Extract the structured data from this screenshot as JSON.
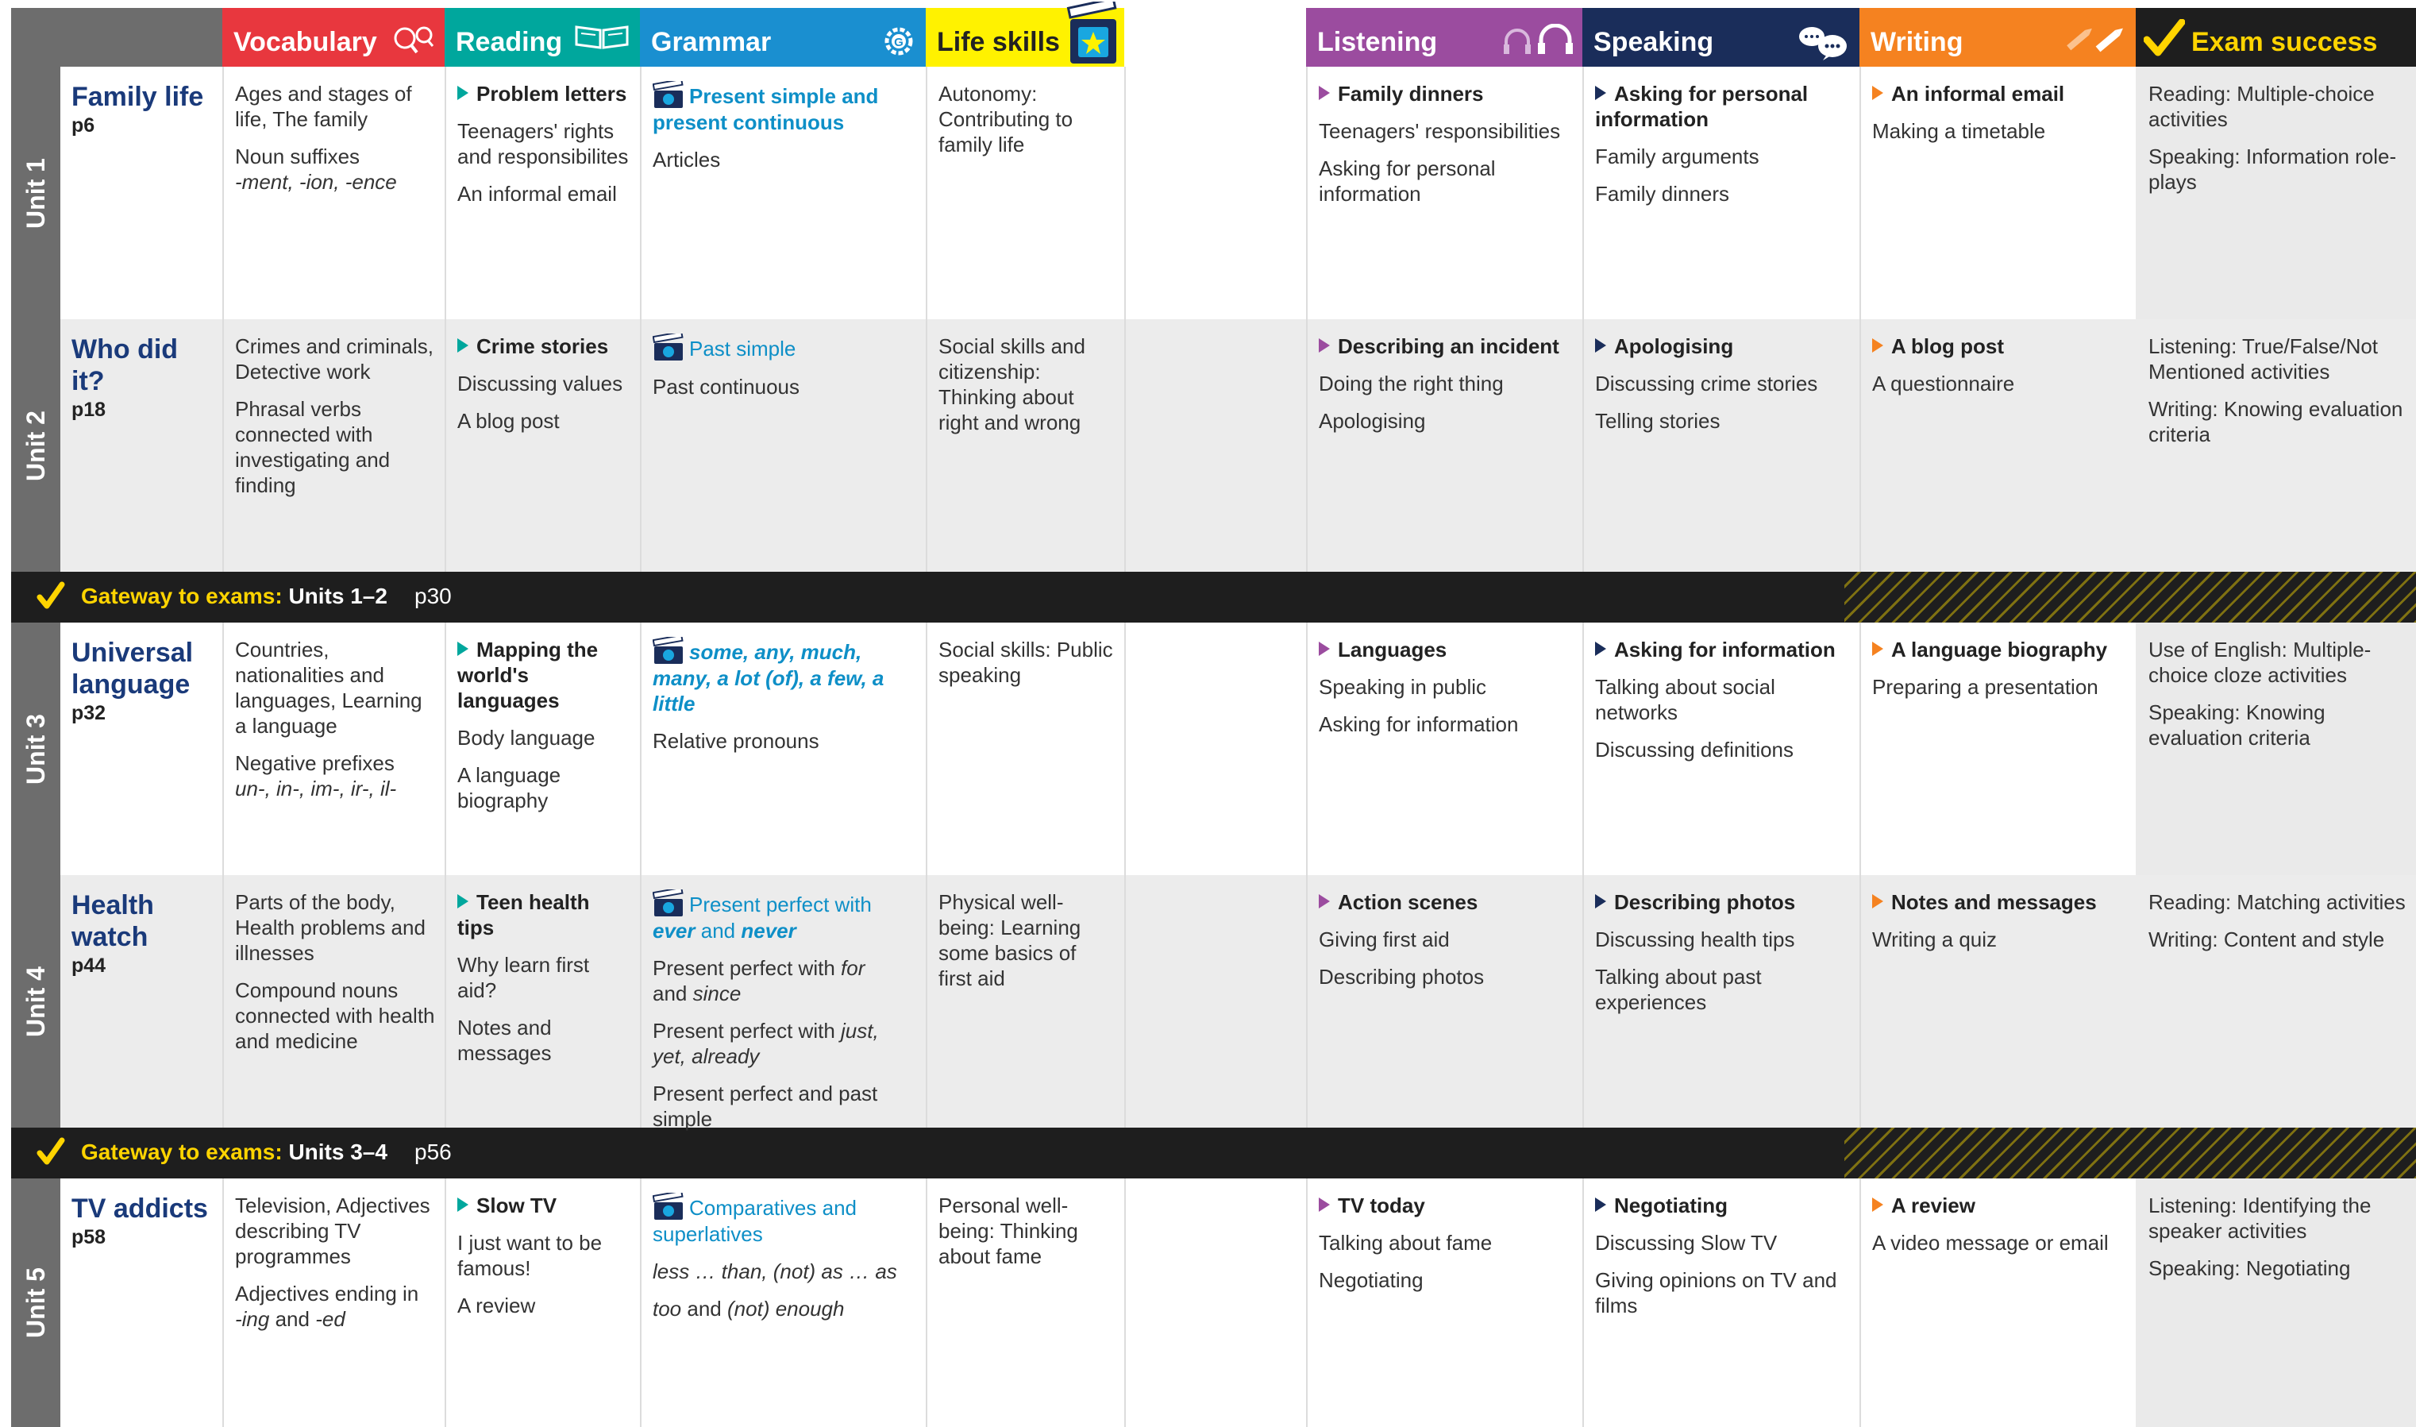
{
  "headers": {
    "vocabulary": "Vocabulary",
    "reading": "Reading",
    "grammar": "Grammar",
    "life_skills": "Life skills",
    "listening": "Listening",
    "speaking": "Speaking",
    "writing": "Writing",
    "exam_success": "Exam success"
  },
  "colors": {
    "vocabulary": "#e8373e",
    "reading": "#00a79d",
    "grammar": "#1a8fd0",
    "life_skills": "#fff200",
    "listening": "#9b4c9f",
    "speaking": "#1a2d5a",
    "writing": "#f58220",
    "exam_success": "#1e1e1e"
  },
  "units": [
    {
      "label": "Unit 1",
      "title": "Family life",
      "page": "p6",
      "vocabulary": [
        "Ages and stages of life, The family",
        "Noun suffixes",
        "-ment, -ion, -ence"
      ],
      "reading": [
        "Problem letters",
        "Teenagers' rights and responsibilites",
        "An informal email"
      ],
      "grammar": [
        "Present simple and present continuous",
        "Articles"
      ],
      "life_skills": [
        "Autonomy: Contributing to family life"
      ],
      "listening": [
        "Family dinners",
        "Teenagers' responsibilities",
        "Asking for personal information"
      ],
      "speaking": [
        "Asking for personal information",
        "Family arguments",
        "Family dinners"
      ],
      "writing": [
        "An informal email",
        "Making a timetable"
      ],
      "exam": [
        "Reading: Multiple-choice activities",
        "Speaking: Information role-plays"
      ]
    },
    {
      "label": "Unit 2",
      "title": "Who did it?",
      "page": "p18",
      "vocabulary": [
        "Crimes and criminals, Detective work",
        "Phrasal verbs connected with investigating and finding"
      ],
      "reading": [
        "Crime stories",
        "Discussing values",
        "A blog post"
      ],
      "grammar": [
        "Past simple",
        "Past continuous"
      ],
      "life_skills": [
        "Social skills and citizenship: Thinking about right and wrong"
      ],
      "listening": [
        "Describing an incident",
        "Doing the right thing",
        "Apologising"
      ],
      "speaking": [
        "Apologising",
        "Discussing crime stories",
        "Telling stories"
      ],
      "writing": [
        "A blog post",
        "A questionnaire"
      ],
      "exam": [
        "Listening: True/False/Not Mentioned activities",
        "Writing: Knowing evaluation criteria"
      ]
    },
    {
      "label": "Unit 3",
      "title": "Universal language",
      "page": "p32",
      "vocabulary": [
        "Countries, nationalities and languages, Learning a language",
        "Negative prefixes",
        "un-, in-, im-, ir-, il-"
      ],
      "reading": [
        "Mapping the world's languages",
        "Body language",
        "A language biography"
      ],
      "grammar": [
        "some, any, much, many, a lot (of), a few, a little",
        "Relative pronouns"
      ],
      "life_skills": [
        "Social skills: Public speaking"
      ],
      "listening": [
        "Languages",
        "Speaking in public",
        "Asking for information"
      ],
      "speaking": [
        "Asking for information",
        "Talking about social networks",
        "Discussing definitions"
      ],
      "writing": [
        "A language biography",
        "Preparing a presentation"
      ],
      "exam": [
        "Use of English: Multiple-choice cloze activities",
        "Speaking: Knowing evaluation criteria"
      ]
    },
    {
      "label": "Unit 4",
      "title": "Health watch",
      "page": "p44",
      "vocabulary": [
        "Parts of the body, Health problems and illnesses",
        "Compound nouns connected with health and medicine"
      ],
      "reading": [
        "Teen health tips",
        "Why learn first aid?",
        "Notes and messages"
      ],
      "grammar": [
        "Present perfect with",
        "ever",
        "and",
        "never",
        "Present perfect with",
        "for",
        "and",
        "since",
        "Present perfect with",
        "just, yet, already",
        "Present perfect and past simple"
      ],
      "life_skills": [
        "Physical well-being: Learning some basics of first aid"
      ],
      "listening": [
        "Action scenes",
        "Giving first aid",
        "Describing photos"
      ],
      "speaking": [
        "Describing photos",
        "Discussing health tips",
        "Talking about past experiences"
      ],
      "writing": [
        "Notes and messages",
        "Writing a quiz"
      ],
      "exam": [
        "Reading: Matching activities",
        "Writing: Content and style"
      ]
    },
    {
      "label": "Unit 5",
      "title": "TV addicts",
      "page": "p58",
      "vocabulary": [
        "Television, Adjectives describing TV programmes",
        "Adjectives ending in",
        "-ing",
        "and",
        "-ed"
      ],
      "reading": [
        "Slow TV",
        "I just want to be famous!",
        "A review"
      ],
      "grammar": [
        "Comparatives and superlatives",
        "less … than, (not) as … as",
        "too",
        "and",
        "(not) enough"
      ],
      "life_skills": [
        "Personal well-being: Thinking about fame"
      ],
      "listening": [
        "TV today",
        "Talking about fame",
        "Negotiating"
      ],
      "speaking": [
        "Negotiating",
        "Discussing Slow TV",
        "Giving opinions on TV and films"
      ],
      "writing": [
        "A review",
        "A video message or email"
      ],
      "exam": [
        "Listening: Identifying the speaker activities",
        "Speaking: Negotiating"
      ]
    }
  ],
  "gateways": [
    {
      "label": "Gateway to exams:",
      "units": "Units 1–2",
      "page": "p30"
    },
    {
      "label": "Gateway to exams:",
      "units": "Units 3–4",
      "page": "p56"
    }
  ]
}
